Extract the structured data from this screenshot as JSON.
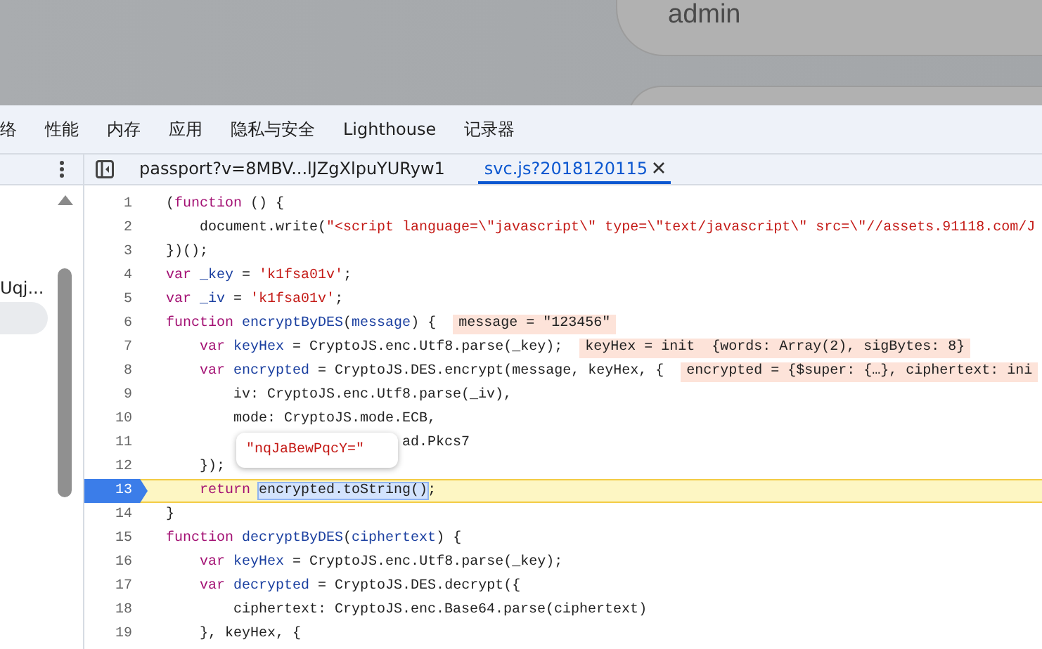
{
  "backdrop": {
    "username_value": "admin"
  },
  "panel_tabs": [
    {
      "label": "络",
      "selected": false
    },
    {
      "label": "性能",
      "selected": false
    },
    {
      "label": "内存",
      "selected": false
    },
    {
      "label": "应用",
      "selected": false
    },
    {
      "label": "隐私与安全",
      "selected": false
    },
    {
      "label": "Lighthouse",
      "selected": false
    },
    {
      "label": "记录器",
      "selected": false
    }
  ],
  "file_tabs": [
    {
      "label": "passport?v=8MBV...lJZgXlpuYURyw1",
      "selected": false,
      "closable": false
    },
    {
      "label": "svc.js?2018120115",
      "selected": true,
      "closable": true
    }
  ],
  "navigator": {
    "label": "Uqj..."
  },
  "code_lines": [
    {
      "number": "1",
      "paused": false,
      "tokens": [
        {
          "kind": "plain",
          "text": "("
        },
        {
          "kind": "kw",
          "text": "function"
        },
        {
          "kind": "plain",
          "text": " () {"
        }
      ]
    },
    {
      "number": "2",
      "paused": false,
      "tokens": [
        {
          "kind": "plain",
          "text": "    document.write("
        },
        {
          "kind": "str",
          "text": "\"<script language=\\\"javascript\\\" type=\\\"text/javascript\\\" src=\\\"//assets.91118.com/J"
        }
      ]
    },
    {
      "number": "3",
      "paused": false,
      "tokens": [
        {
          "kind": "plain",
          "text": "})();"
        }
      ]
    },
    {
      "number": "4",
      "paused": false,
      "tokens": [
        {
          "kind": "kw",
          "text": "var "
        },
        {
          "kind": "def",
          "text": "_key"
        },
        {
          "kind": "plain",
          "text": " = "
        },
        {
          "kind": "str",
          "text": "'k1fsa01v'"
        },
        {
          "kind": "plain",
          "text": ";"
        }
      ]
    },
    {
      "number": "5",
      "paused": false,
      "tokens": [
        {
          "kind": "kw",
          "text": "var "
        },
        {
          "kind": "def",
          "text": "_iv"
        },
        {
          "kind": "plain",
          "text": " = "
        },
        {
          "kind": "str",
          "text": "'k1fsa01v'"
        },
        {
          "kind": "plain",
          "text": ";"
        }
      ]
    },
    {
      "number": "6",
      "paused": false,
      "tokens": [
        {
          "kind": "kw",
          "text": "function "
        },
        {
          "kind": "def",
          "text": "encryptByDES"
        },
        {
          "kind": "plain",
          "text": "("
        },
        {
          "kind": "def",
          "text": "message"
        },
        {
          "kind": "plain",
          "text": ") {"
        }
      ],
      "inline_value": "message = \"123456\""
    },
    {
      "number": "7",
      "paused": false,
      "tokens": [
        {
          "kind": "kw",
          "text": "    var "
        },
        {
          "kind": "def",
          "text": "keyHex"
        },
        {
          "kind": "plain",
          "text": " = CryptoJS.enc.Utf8.parse(_key);"
        }
      ],
      "inline_value": "keyHex = init  {words: Array(2), sigBytes: 8}"
    },
    {
      "number": "8",
      "paused": false,
      "tokens": [
        {
          "kind": "kw",
          "text": "    var "
        },
        {
          "kind": "def",
          "text": "encrypted"
        },
        {
          "kind": "plain",
          "text": " = CryptoJS.DES.encrypt(message, keyHex, {"
        }
      ],
      "inline_value": "encrypted = {$super: {…}, ciphertext: ini"
    },
    {
      "number": "9",
      "paused": false,
      "tokens": [
        {
          "kind": "plain",
          "text": "        iv: CryptoJS.enc.Utf8.parse(_iv),"
        }
      ]
    },
    {
      "number": "10",
      "paused": false,
      "tokens": [
        {
          "kind": "plain",
          "text": "        mode: CryptoJS.mode.ECB,"
        }
      ]
    },
    {
      "number": "11",
      "paused": false,
      "tokens": [
        {
          "kind": "plain",
          "text": "                            ad.Pkcs7"
        }
      ]
    },
    {
      "number": "12",
      "paused": false,
      "tokens": [
        {
          "kind": "plain",
          "text": "    });"
        }
      ]
    },
    {
      "number": "13",
      "paused": true,
      "tokens": [
        {
          "kind": "kw",
          "text": "    return "
        },
        {
          "kind": "sel",
          "text": "encrypted.toString()"
        },
        {
          "kind": "plain",
          "text": ";"
        }
      ]
    },
    {
      "number": "14",
      "paused": false,
      "tokens": [
        {
          "kind": "plain",
          "text": "}"
        }
      ]
    },
    {
      "number": "15",
      "paused": false,
      "tokens": [
        {
          "kind": "kw",
          "text": "function "
        },
        {
          "kind": "def",
          "text": "decryptByDES"
        },
        {
          "kind": "plain",
          "text": "("
        },
        {
          "kind": "def",
          "text": "ciphertext"
        },
        {
          "kind": "plain",
          "text": ") {"
        }
      ]
    },
    {
      "number": "16",
      "paused": false,
      "tokens": [
        {
          "kind": "kw",
          "text": "    var "
        },
        {
          "kind": "def",
          "text": "keyHex"
        },
        {
          "kind": "plain",
          "text": " = CryptoJS.enc.Utf8.parse(_key);"
        }
      ]
    },
    {
      "number": "17",
      "paused": false,
      "tokens": [
        {
          "kind": "kw",
          "text": "    var "
        },
        {
          "kind": "def",
          "text": "decrypted"
        },
        {
          "kind": "plain",
          "text": " = CryptoJS.DES.decrypt({"
        }
      ]
    },
    {
      "number": "18",
      "paused": false,
      "tokens": [
        {
          "kind": "plain",
          "text": "        ciphertext: CryptoJS.enc.Base64.parse(ciphertext)"
        }
      ]
    },
    {
      "number": "19",
      "paused": false,
      "tokens": [
        {
          "kind": "plain",
          "text": "    }, keyHex, {"
        }
      ]
    }
  ],
  "hover_tooltip": {
    "value": "\"nqJaBewPqcY=\""
  }
}
